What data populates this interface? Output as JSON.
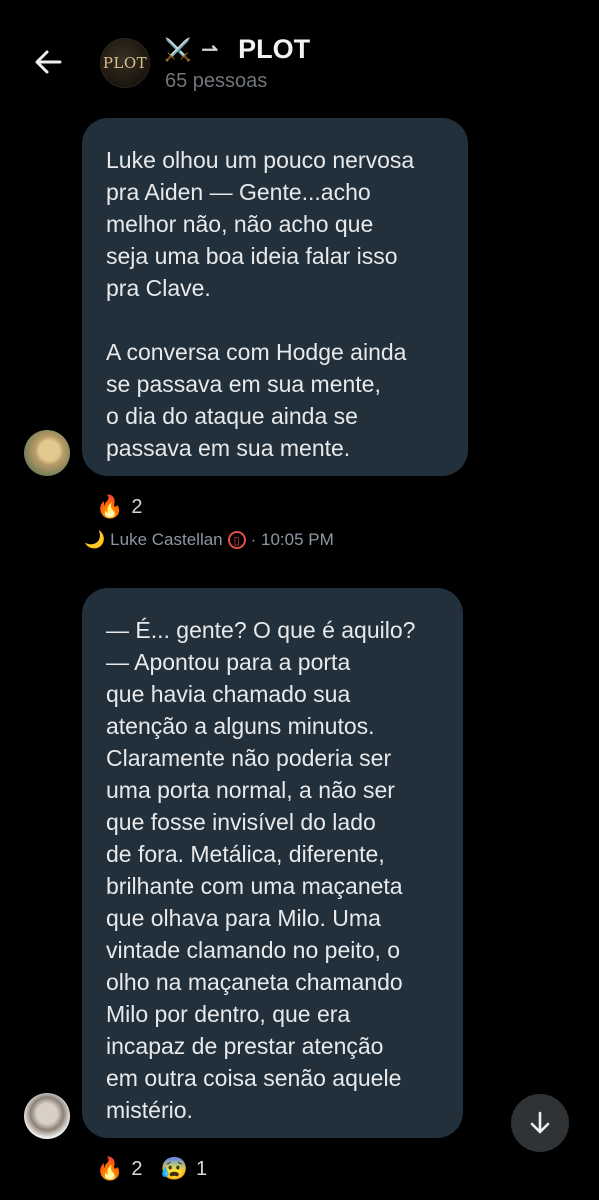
{
  "header": {
    "title_emoji": "⚔️",
    "title_arrow": "⇀",
    "title": "PLOT",
    "avatar_text": "PLOT",
    "members": "65 pessoas"
  },
  "messages": [
    {
      "text": "Luke olhou um pouco nervosa\npra Aiden — Gente...acho\nmelhor não, não acho que\nseja uma boa ideia falar isso\npra Clave.\n\nA conversa com Hodge ainda\nse passava em sua mente,\no dia do ataque ainda se\npassava em sua mente.",
      "reactions": [
        {
          "emoji": "🔥",
          "count": "2"
        }
      ],
      "sender": "Luke Castellan",
      "sender_prefix": "🌙",
      "time": "· 10:05 PM"
    },
    {
      "text": "— É... gente? O que é aquilo?\n— Apontou para a porta\nque havia chamado sua\natenção a alguns minutos.\nClaramente não poderia ser\numa porta normal, a não ser\nque fosse invisível do lado\nde fora. Metálica, diferente,\nbrilhante com uma maçaneta\nque olhava para Milo.  Uma\nvintade clamando no peito, o\nolho na maçaneta chamando\nMilo por dentro, que era\nincapaz de prestar atenção\nem outra coisa senão aquele\nmistério.",
      "reactions": [
        {
          "emoji": "🔥",
          "count": "2"
        },
        {
          "emoji": "😰",
          "count": "1"
        }
      ]
    }
  ],
  "colors": {
    "background": "#000000",
    "bubble": "#22303c",
    "secondary_text": "#71767b"
  }
}
